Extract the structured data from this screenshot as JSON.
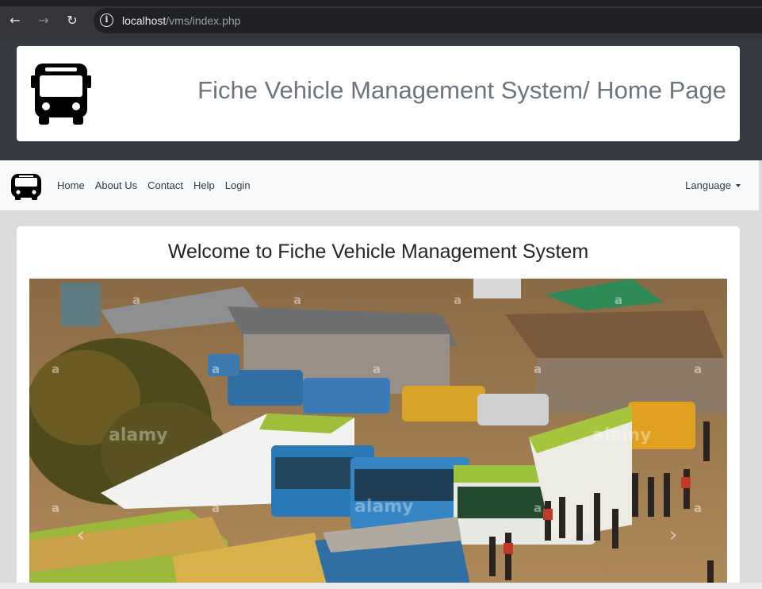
{
  "browser": {
    "back_icon": "←",
    "forward_icon": "→",
    "reload_icon": "↻",
    "info_icon": "i",
    "url_host": "localhost",
    "url_path": "/vms/index.php"
  },
  "header": {
    "title": "Fiche Vehicle Management System/ Home Page",
    "logo_icon": "bus-icon"
  },
  "navbar": {
    "logo_icon": "bus-icon",
    "links": [
      "Home",
      "About Us",
      "Contact",
      "Help",
      "Login"
    ],
    "language": "Language"
  },
  "main": {
    "welcome": "Welcome to Fiche Vehicle Management System",
    "carousel": {
      "prev_icon": "‹",
      "next_icon": "›",
      "watermark": "alamy",
      "watermark_mark": "a"
    }
  },
  "colors": {
    "dark_bg": "#343a40",
    "navbar_bg": "#f8f9fa",
    "title_gray": "#6c757d"
  }
}
